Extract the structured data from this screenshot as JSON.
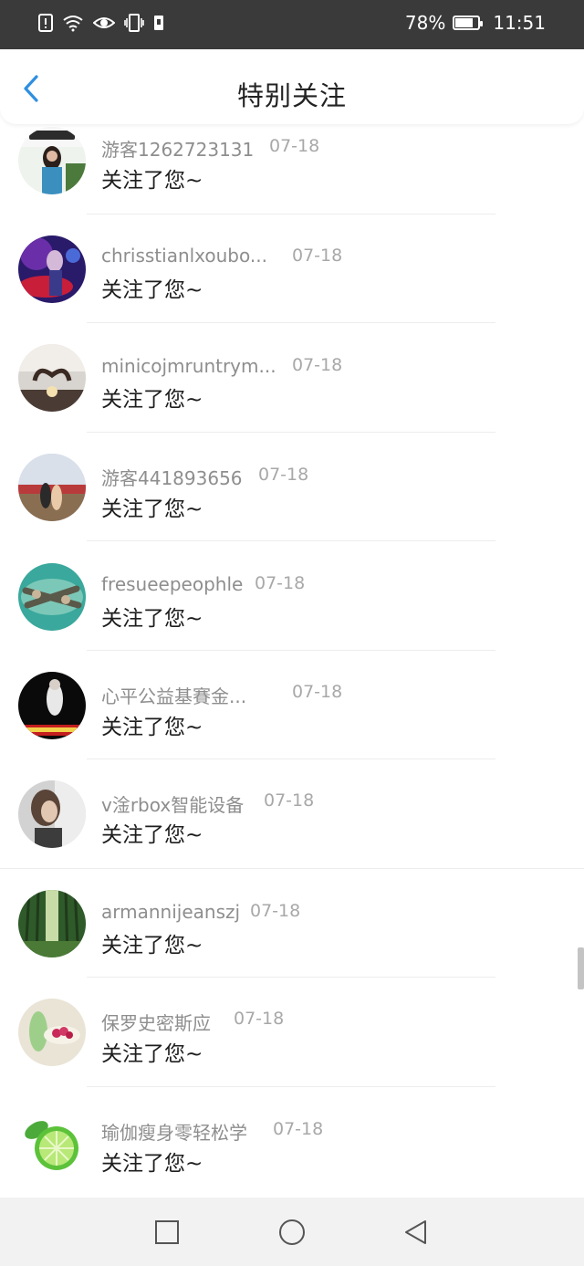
{
  "status_bar": {
    "battery_percent": "78%",
    "battery_level": 0.78,
    "time": "11:51",
    "icons": [
      "alert-icon",
      "wifi-icon",
      "eye-icon",
      "vibrate-icon",
      "sim-icon"
    ]
  },
  "header": {
    "title": "特别关注",
    "back_icon": "chevron-left-icon",
    "accent_color": "#2f8fe0"
  },
  "items": [
    {
      "name": "游客1262723131",
      "date": "07-18",
      "message": "关注了您~"
    },
    {
      "name": "chrisstianlxoubo...",
      "date": "07-18",
      "message": "关注了您~"
    },
    {
      "name": "minicojmruntrym...",
      "date": "07-18",
      "message": "关注了您~"
    },
    {
      "name": "游客441893656",
      "date": "07-18",
      "message": "关注了您~"
    },
    {
      "name": "fresueepeophle",
      "date": "07-18",
      "message": "关注了您~"
    },
    {
      "name": "心平公益基賽金...",
      "date": "07-18",
      "message": "关注了您~"
    },
    {
      "name": "v淦rbox智能设备",
      "date": "07-18",
      "message": "关注了您~"
    },
    {
      "name": "armannijeanszj",
      "date": "07-18",
      "message": "关注了您~"
    },
    {
      "name": "保罗史密斯应",
      "date": "07-18",
      "message": "关注了您~"
    },
    {
      "name": "瑜伽瘦身零轻松学",
      "date": "07-18",
      "message": "关注了您~"
    }
  ],
  "nav_bar": {
    "buttons": [
      "recent-apps-icon",
      "home-icon",
      "back-icon"
    ]
  }
}
